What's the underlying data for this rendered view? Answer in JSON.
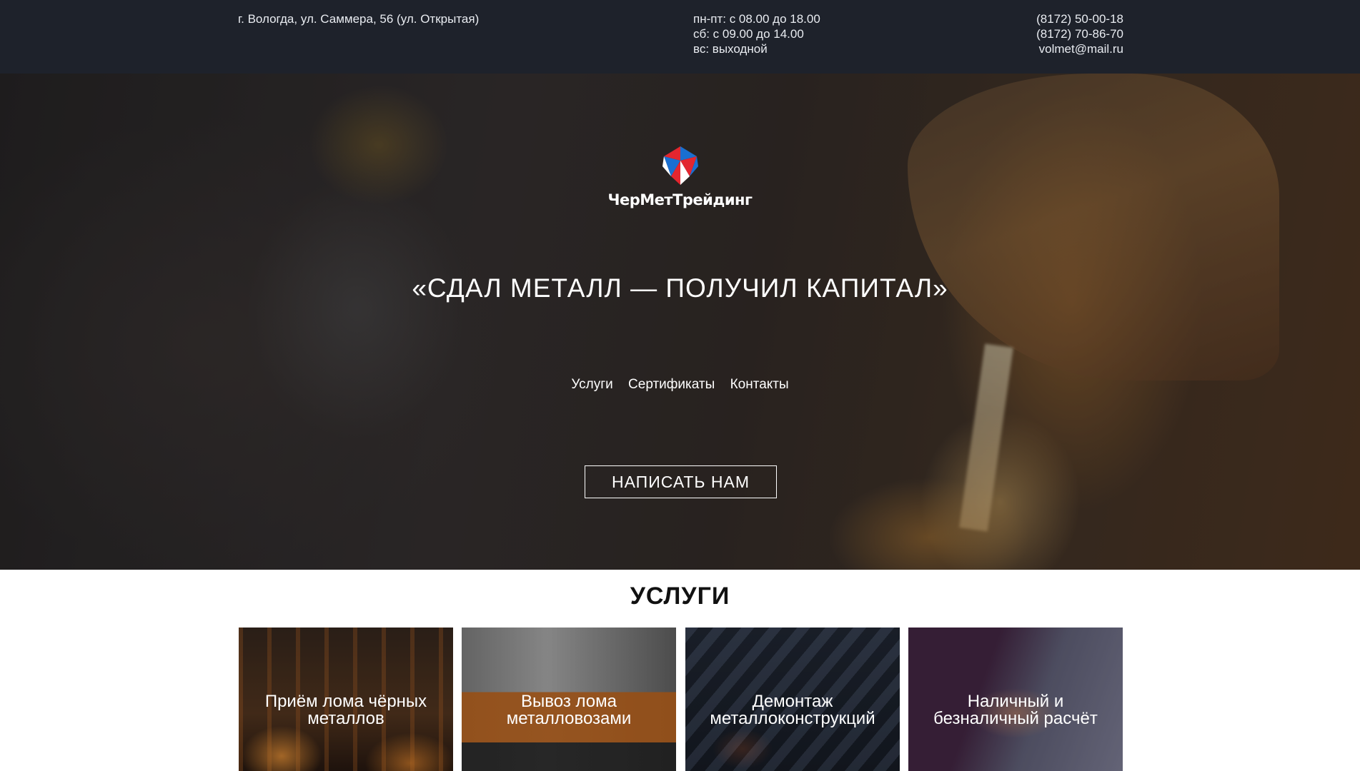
{
  "topbar": {
    "address": "г. Вологда, ул. Саммера, 56 (ул. Открытая)",
    "hours": [
      "пн-пт: с 08.00 до 18.00",
      "сб: с 09.00 до 14.00",
      "вс: выходной"
    ],
    "phones": [
      "(8172) 50-00-18",
      "(8172) 70-86-70"
    ],
    "email": "volmet@mail.ru"
  },
  "hero": {
    "logo_text": "ЧерМетТрейдинг",
    "slogan": "«СДАЛ МЕТАЛЛ — ПОЛУЧИЛ КАПИТАЛ»",
    "nav": [
      "Услуги",
      "Сертификаты",
      "Контакты"
    ],
    "cta_label": "НАПИСАТЬ НАМ"
  },
  "services": {
    "title": "УСЛУГИ",
    "cards": [
      "Приём лома чёрных металлов",
      "Вывоз лома металловозами",
      "Демонтаж металлоконструкций",
      "Наличный и безналичный расчёт"
    ]
  },
  "colors": {
    "topbar_bg": "#1e222b",
    "logo_red": "#e3262f",
    "logo_blue": "#1a6fd1"
  }
}
